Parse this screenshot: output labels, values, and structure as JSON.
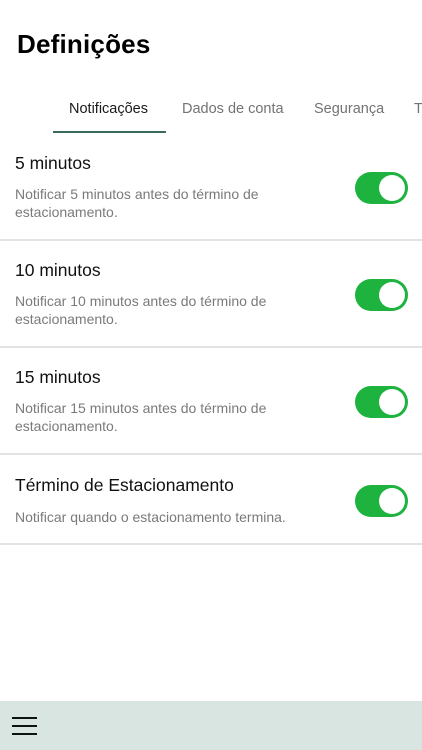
{
  "header": {
    "title": "Definições"
  },
  "tabs": [
    {
      "label": "Notificações",
      "active": true
    },
    {
      "label": "Dados de conta",
      "active": false
    },
    {
      "label": "Segurança",
      "active": false
    },
    {
      "label": "T",
      "active": false
    }
  ],
  "settings": [
    {
      "title": "5 minutos",
      "description": "Notificar 5 minutos antes do término de estacionamento.",
      "enabled": true
    },
    {
      "title": "10 minutos",
      "description": "Notificar 10 minutos antes do término de estacionamento.",
      "enabled": true
    },
    {
      "title": "15 minutos",
      "description": "Notificar 15 minutos antes do término de estacionamento.",
      "enabled": true
    },
    {
      "title": "Término de Estacionamento",
      "description": "Notificar quando o estacionamento termina.",
      "enabled": true
    }
  ],
  "bottom_bar": {
    "menu_icon": "hamburger-menu-icon"
  },
  "colors": {
    "toggle_on": "#1db33e",
    "tab_indicator": "#3a6b5a",
    "bottom_bar": "#d9e5e0"
  }
}
